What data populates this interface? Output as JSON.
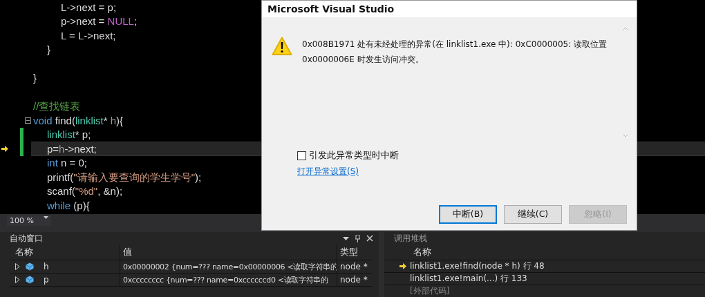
{
  "editor": {
    "lines": [
      {
        "kind": "block",
        "children": [
          {
            "kind": "block",
            "children": [
              {
                "kind": "code",
                "tokens": [
                  {
                    "text": "L->next = p;",
                    "kind": "plain"
                  }
                ],
                "current": false,
                "changed": false,
                "foldable": false
              },
              {
                "kind": "code",
                "tokens": [
                  {
                    "text": "p->next = ",
                    "kind": "plain"
                  },
                  {
                    "text": "NULL",
                    "kind": "macro"
                  },
                  {
                    "text": ";",
                    "kind": "plain"
                  }
                ],
                "current": false,
                "changed": false,
                "foldable": false
              },
              {
                "kind": "code",
                "tokens": [
                  {
                    "text": "L = L->next;",
                    "kind": "plain"
                  }
                ],
                "current": false,
                "changed": false,
                "foldable": false
              }
            ]
          },
          {
            "kind": "code",
            "tokens": [
              {
                "text": "}",
                "kind": "plain"
              }
            ],
            "current": false,
            "changed": false,
            "foldable": false
          },
          {
            "kind": "blank"
          }
        ]
      },
      {
        "kind": "code",
        "tokens": [
          {
            "text": "}",
            "kind": "plain"
          }
        ],
        "current": false,
        "changed": false,
        "foldable": false
      },
      {
        "kind": "blank"
      },
      {
        "kind": "code",
        "tokens": [
          {
            "text": "//查找链表",
            "kind": "comment"
          }
        ],
        "current": false,
        "changed": false,
        "foldable": false
      },
      {
        "kind": "code",
        "tokens": [
          {
            "text": "void",
            "kind": "keyword"
          },
          {
            "text": " find(",
            "kind": "plain"
          },
          {
            "text": "linklist",
            "kind": "type"
          },
          {
            "text": "* ",
            "kind": "plain"
          },
          {
            "text": "h",
            "kind": "param"
          },
          {
            "text": "){",
            "kind": "plain"
          }
        ],
        "current": false,
        "changed": false,
        "foldable": true,
        "children": [
          {
            "kind": "code",
            "tokens": [
              {
                "text": "linklist",
                "kind": "type"
              },
              {
                "text": "* p;",
                "kind": "plain"
              }
            ],
            "current": false,
            "changed": true,
            "foldable": false
          },
          {
            "kind": "code",
            "tokens": [
              {
                "text": "p=",
                "kind": "plain"
              },
              {
                "text": "h",
                "kind": "param"
              },
              {
                "text": "->next;",
                "kind": "plain"
              }
            ],
            "current": true,
            "changed": true,
            "foldable": false
          },
          {
            "kind": "code",
            "tokens": [
              {
                "text": "int",
                "kind": "keyword"
              },
              {
                "text": " n = 0;",
                "kind": "plain"
              }
            ],
            "current": false,
            "changed": false,
            "foldable": false
          },
          {
            "kind": "code",
            "tokens": [
              {
                "text": "printf(",
                "kind": "plain"
              },
              {
                "text": "\"请输入要查询的学生学号\"",
                "kind": "string"
              },
              {
                "text": ");",
                "kind": "plain"
              }
            ],
            "current": false,
            "changed": false,
            "foldable": false
          },
          {
            "kind": "code",
            "tokens": [
              {
                "text": "scanf(",
                "kind": "plain"
              },
              {
                "text": "\"%d\"",
                "kind": "string"
              },
              {
                "text": ", &n);",
                "kind": "plain"
              }
            ],
            "current": false,
            "changed": false,
            "foldable": false
          },
          {
            "kind": "code",
            "tokens": [
              {
                "text": "while",
                "kind": "keyword"
              },
              {
                "text": " (p){",
                "kind": "plain"
              }
            ],
            "current": false,
            "changed": false,
            "foldable": false
          }
        ]
      }
    ]
  },
  "zoom": {
    "value": "100 %"
  },
  "autos": {
    "title": "自动窗口",
    "columns": [
      "名称",
      "值",
      "类型"
    ],
    "rows": [
      {
        "name": "h",
        "value": "0x00000002 {num=??? name=0x00000006 <读取字符串的",
        "type": "node *"
      },
      {
        "name": "p",
        "value": "0xcccccccc {num=??? name=0xccccccd0 <读取字符串的",
        "type": "node *"
      }
    ]
  },
  "call_stack": {
    "title": "调用堆栈",
    "columns": [
      "名称"
    ],
    "rows": [
      {
        "text": "linklist1.exe!find(node * h) 行 48",
        "current": true,
        "external": false
      },
      {
        "text": "linklist1.exe!main(...) 行 133",
        "current": false,
        "external": false
      },
      {
        "text": "[外部代码]",
        "current": false,
        "external": true
      }
    ]
  },
  "dialog": {
    "title": "Microsoft Visual Studio",
    "message": "0x008B1971 处有未经处理的异常(在 linklist1.exe 中):  0xC0000005:  读取位置\n0x0000006E 时发生访问冲突。",
    "checkbox": {
      "label": "引发此异常类型时中断",
      "checked": false
    },
    "link": "打开异常设置(S)",
    "buttons": [
      {
        "label": "中断(B)",
        "focused": true,
        "disabled": false
      },
      {
        "label": "继续(C)",
        "focused": false,
        "disabled": false
      },
      {
        "label": "忽略(I)",
        "focused": false,
        "disabled": true
      }
    ]
  }
}
